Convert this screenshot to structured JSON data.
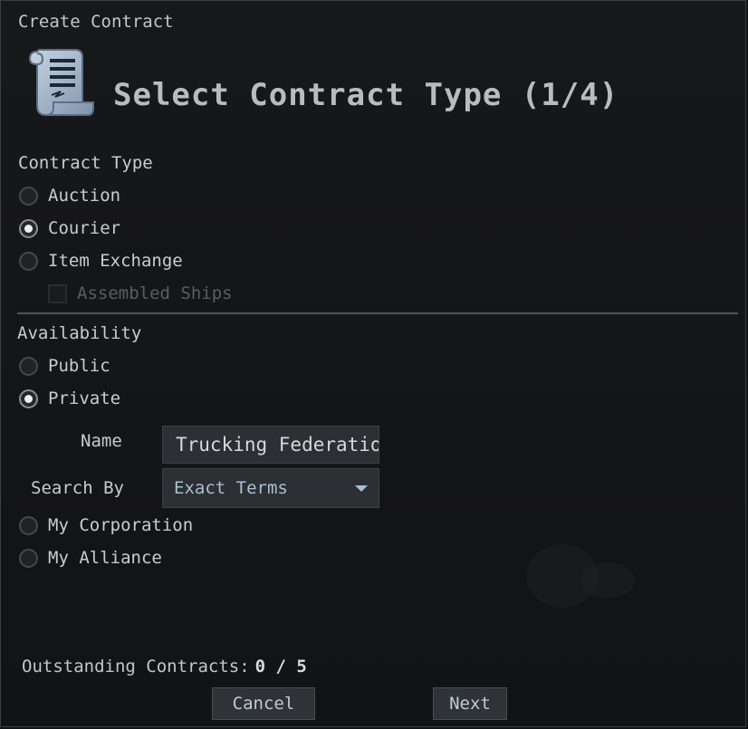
{
  "window": {
    "title": "Create Contract"
  },
  "header": {
    "icon": "contract-scroll-icon",
    "title": "Select Contract Type (1/4)"
  },
  "contract_type": {
    "label": "Contract Type",
    "options": [
      {
        "label": "Auction",
        "selected": false
      },
      {
        "label": "Courier",
        "selected": true
      },
      {
        "label": "Item Exchange",
        "selected": false
      }
    ],
    "assembled_ships": {
      "label": "Assembled Ships",
      "checked": false,
      "enabled": false
    }
  },
  "availability": {
    "label": "Availability",
    "options": [
      {
        "label": "Public",
        "selected": false
      },
      {
        "label": "Private",
        "selected": true
      }
    ],
    "name": {
      "label": "Name",
      "value": "Trucking Federation"
    },
    "search_by": {
      "label": "Search By",
      "value": "Exact Terms"
    },
    "more_options": [
      {
        "label": "My Corporation",
        "selected": false
      },
      {
        "label": "My Alliance",
        "selected": false
      }
    ]
  },
  "footer": {
    "outstanding_label": "Outstanding Contracts:",
    "outstanding_value": "0 / 5",
    "cancel_label": "Cancel",
    "next_label": "Next"
  }
}
